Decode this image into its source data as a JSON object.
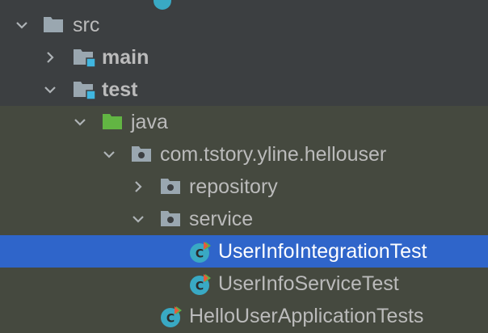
{
  "colors": {
    "panel_bg": "#3c3f41",
    "test_scope_bg": "#45493f",
    "selection": "#2f65ca",
    "text": "#bbbbbb",
    "folder_grey": "#9aa7b0",
    "source_folder_green": "#62b543",
    "module_marker_blue": "#40b6e0",
    "class_icon_teal": "#39a9c4",
    "test_marker_red": "#e55b3c",
    "test_marker_green": "#5bb146"
  },
  "tree": {
    "items": [
      {
        "label": "src",
        "icon": "folder-icon",
        "expanded": true,
        "bold": false
      },
      {
        "label": "main",
        "icon": "module-folder-icon",
        "expanded": false,
        "bold": true
      },
      {
        "label": "test",
        "icon": "module-folder-icon",
        "expanded": true,
        "bold": true
      },
      {
        "label": "java",
        "icon": "test-source-folder-icon",
        "expanded": true,
        "bold": false
      },
      {
        "label": "com.tstory.yline.hellouser",
        "icon": "package-icon",
        "expanded": true,
        "bold": false
      },
      {
        "label": "repository",
        "icon": "package-icon",
        "expanded": false,
        "bold": false
      },
      {
        "label": "service",
        "icon": "package-icon",
        "expanded": true,
        "bold": false
      },
      {
        "label": "UserInfoIntegrationTest",
        "icon": "test-class-icon",
        "selected": true,
        "bold": false
      },
      {
        "label": "UserInfoServiceTest",
        "icon": "test-class-icon",
        "selected": false,
        "bold": false
      },
      {
        "label": "HelloUserApplicationTests",
        "icon": "test-class-icon",
        "selected": false,
        "bold": false
      }
    ]
  }
}
